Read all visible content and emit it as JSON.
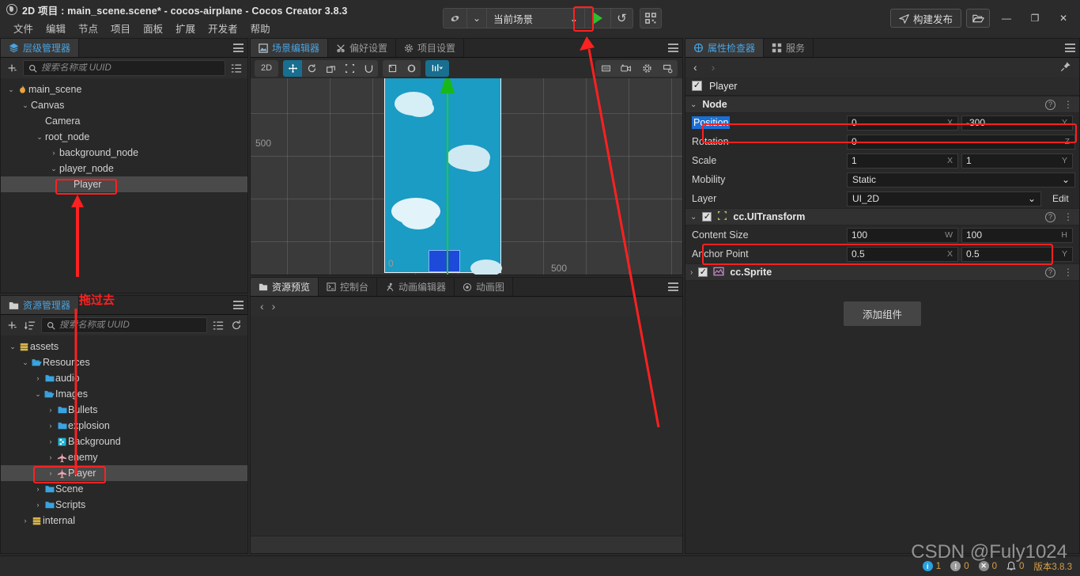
{
  "window": {
    "title": "2D 项目 : main_scene.scene* - cocos-airplane - Cocos Creator 3.8.3",
    "app_icon": "cocos-logo-icon",
    "minimize": "—",
    "maximize": "❐",
    "close": "✕"
  },
  "menubar": {
    "items": [
      {
        "label": "文件"
      },
      {
        "label": "编辑"
      },
      {
        "label": "节点"
      },
      {
        "label": "项目"
      },
      {
        "label": "面板"
      },
      {
        "label": "扩展"
      },
      {
        "label": "开发者"
      },
      {
        "label": "帮助"
      }
    ]
  },
  "toolbar": {
    "platform_icon": "browser-globe-icon",
    "platform_caret": "⌄",
    "scene_mode": "当前场景",
    "scene_caret": "⌄",
    "play_label": "▶",
    "refresh_label": "↺",
    "qrcode_label": "qr-code-icon",
    "build_label": "构建发布",
    "build_icon": "paper-plane-icon",
    "folder_icon": "open-folder-icon"
  },
  "hierarchy": {
    "tab_label": "层级管理器",
    "tab_icon": "layers-icon",
    "menu_icon": "hamburger-icon",
    "add_icon": "add-node-icon",
    "filter_icon": "filter-list-icon",
    "search": {
      "placeholder": "搜索名称或 UUID",
      "value": ""
    },
    "nodes": [
      {
        "label": "main_scene",
        "depth": 0,
        "arrow": "⌄",
        "icon": "scene-flame-icon",
        "selected": false
      },
      {
        "label": "Canvas",
        "depth": 1,
        "arrow": "⌄",
        "icon": "",
        "selected": false
      },
      {
        "label": "Camera",
        "depth": 2,
        "arrow": "",
        "icon": "",
        "selected": false
      },
      {
        "label": "root_node",
        "depth": 2,
        "arrow": "⌄",
        "icon": "",
        "selected": false
      },
      {
        "label": "background_node",
        "depth": 3,
        "arrow": "›",
        "icon": "",
        "selected": false
      },
      {
        "label": "player_node",
        "depth": 3,
        "arrow": "⌄",
        "icon": "",
        "selected": false
      },
      {
        "label": "Player",
        "depth": 4,
        "arrow": "",
        "icon": "",
        "selected": true
      }
    ]
  },
  "assets": {
    "tab_label": "资源管理器",
    "tab_icon": "folder-icon",
    "menu_icon": "hamburger-icon",
    "add_icon": "add-asset-icon",
    "sort_icon": "sort-icon",
    "view_icon": "list-view-icon",
    "refresh_icon": "refresh-icon",
    "search": {
      "placeholder": "搜索名称或 UUID",
      "value": ""
    },
    "tree": [
      {
        "label": "assets",
        "depth": 0,
        "arrow": "⌄",
        "icon": "db-icon",
        "selected": false
      },
      {
        "label": "Resources",
        "depth": 1,
        "arrow": "⌄",
        "icon": "folder-open-icon",
        "selected": false
      },
      {
        "label": "audio",
        "depth": 2,
        "arrow": "›",
        "icon": "folder-icon",
        "selected": false
      },
      {
        "label": "Images",
        "depth": 2,
        "arrow": "⌄",
        "icon": "folder-open-icon",
        "selected": false
      },
      {
        "label": "Bullets",
        "depth": 3,
        "arrow": "›",
        "icon": "folder-icon",
        "selected": false
      },
      {
        "label": "explosion",
        "depth": 3,
        "arrow": "›",
        "icon": "folder-icon",
        "selected": false
      },
      {
        "label": "Background",
        "depth": 3,
        "arrow": "›",
        "icon": "sprite-icon",
        "selected": false
      },
      {
        "label": "enemy",
        "depth": 3,
        "arrow": "›",
        "icon": "plane-icon",
        "selected": false
      },
      {
        "label": "Player",
        "depth": 3,
        "arrow": "›",
        "icon": "plane-icon",
        "selected": true
      },
      {
        "label": "Scene",
        "depth": 2,
        "arrow": "›",
        "icon": "folder-icon",
        "selected": false
      },
      {
        "label": "Scripts",
        "depth": 2,
        "arrow": "›",
        "icon": "folder-icon",
        "selected": false
      },
      {
        "label": "internal",
        "depth": 1,
        "arrow": "›",
        "icon": "db-icon",
        "selected": false
      }
    ]
  },
  "scene_panel": {
    "tabs": [
      {
        "label": "场景编辑器",
        "icon": "scene-icon",
        "active": true
      },
      {
        "label": "偏好设置",
        "icon": "preferences-icon",
        "active": false
      },
      {
        "label": "项目设置",
        "icon": "gear-icon",
        "active": false
      }
    ],
    "menu_icon": "hamburger-icon",
    "tools": [
      {
        "label": "2D",
        "name": "toggle-2d-button",
        "active": false
      },
      {
        "label": "✥",
        "name": "move-tool",
        "active": true
      },
      {
        "label": "↻",
        "name": "rotate-tool",
        "active": false
      },
      {
        "label": "⧉",
        "name": "scale-tool",
        "active": false
      },
      {
        "label": "⬚",
        "name": "rect-transform-tool",
        "active": false
      },
      {
        "label": "∪",
        "name": "magnet-snap-tool",
        "active": false
      }
    ],
    "tools_group2": [
      {
        "label": "◳",
        "name": "pivot-toggle"
      },
      {
        "label": "◈",
        "name": "coordinate-toggle"
      }
    ],
    "gizmo_menu": {
      "label": "⦀",
      "caret": "⌄",
      "name": "gizmo-options"
    },
    "right_tools": [
      {
        "label": "⊡",
        "name": "ruler-icon"
      },
      {
        "label": "🎥",
        "name": "camera-icon"
      },
      {
        "label": "⚙",
        "name": "scene-settings-gear-icon"
      },
      {
        "label": "⛶",
        "name": "scene-view-config-icon"
      }
    ],
    "axis_labels": {
      "left": "500",
      "origin": "0",
      "right": "500"
    }
  },
  "preview_panel": {
    "tabs": [
      {
        "label": "资源预览",
        "icon": "assets-preview-icon",
        "active": true
      },
      {
        "label": "控制台",
        "icon": "console-icon",
        "active": false
      },
      {
        "label": "动画编辑器",
        "icon": "animation-editor-icon",
        "active": false
      },
      {
        "label": "动画图",
        "icon": "animation-graph-icon",
        "active": false
      }
    ],
    "menu_icon": "hamburger-icon",
    "back_arrow": "‹",
    "forward_arrow": "›"
  },
  "inspector": {
    "tabs": [
      {
        "label": "属性检查器",
        "icon": "inspector-icon",
        "active": true
      },
      {
        "label": "服务",
        "icon": "services-icon",
        "active": false
      }
    ],
    "menu_icon": "hamburger-icon",
    "back_arrow": "‹",
    "forward_arrow": "›",
    "pin_icon": "pin-icon",
    "node_name": "Player",
    "node_enabled": "✓",
    "sections": {
      "node": {
        "title": "Node",
        "collapse_arrow": "⌄",
        "help_icon": "?",
        "menu_icon": "⋮",
        "position": {
          "label": "Position",
          "x": "0",
          "x_axis": "X",
          "y": "-300",
          "y_axis": "Y",
          "highlighted": true
        },
        "rotation": {
          "label": "Rotation",
          "z": "0",
          "z_axis": "Z"
        },
        "scale": {
          "label": "Scale",
          "x": "1",
          "x_axis": "X",
          "y": "1",
          "y_axis": "Y"
        },
        "mobility": {
          "label": "Mobility",
          "value": "Static",
          "caret": "⌄"
        },
        "layer": {
          "label": "Layer",
          "value": "UI_2D",
          "caret": "⌄",
          "edit_label": "Edit"
        }
      },
      "uitransform": {
        "title": "cc.UITransform",
        "collapse_arrow": "⌄",
        "enabled": "✓",
        "icon": "uitransform-icon",
        "help_icon": "?",
        "menu_icon": "⋮",
        "content_size": {
          "label": "Content Size",
          "w": "100",
          "w_axis": "W",
          "h": "100",
          "h_axis": "H"
        },
        "anchor_point": {
          "label": "Anchor Point",
          "x": "0.5",
          "x_axis": "X",
          "y": "0.5",
          "y_axis": "Y"
        }
      },
      "sprite": {
        "title": "cc.Sprite",
        "collapse_arrow": "›",
        "enabled": "✓",
        "icon": "sprite-icon",
        "help_icon": "?",
        "menu_icon": "⋮"
      }
    },
    "add_component_label": "添加组件"
  },
  "annotations": {
    "drag_label": "拖过去",
    "accent_red": "#ff2020"
  },
  "statusbar": {
    "info_count": "1",
    "warn_count": "0",
    "error_count": "0",
    "bell_count": "0",
    "version": "版本3.8.3",
    "info_icon": "info-icon",
    "warn_icon": "warning-icon",
    "error_icon": "error-icon",
    "bell_icon": "bell-icon"
  },
  "watermark": "CSDN @Fuly1024"
}
